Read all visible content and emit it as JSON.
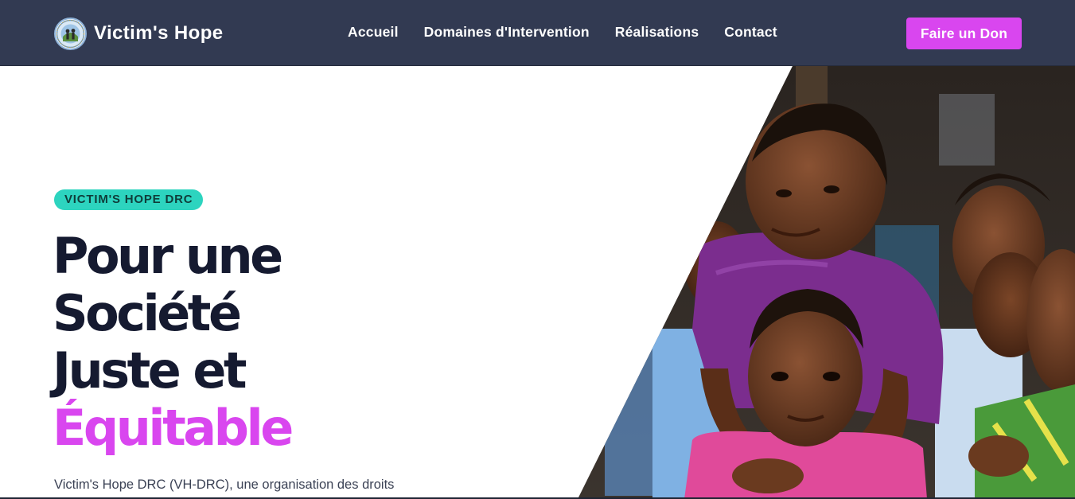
{
  "brand": {
    "name": "Victim's Hope",
    "logo_icon": "victims-hope-emblem"
  },
  "nav": {
    "items": [
      {
        "label": "Accueil"
      },
      {
        "label": "Domaines d'Intervention"
      },
      {
        "label": "Réalisations"
      },
      {
        "label": "Contact"
      }
    ],
    "donate_label": "Faire un Don"
  },
  "hero": {
    "badge": "VICTIM'S HOPE DRC",
    "title_lines": [
      "Pour une",
      "Société",
      "Juste et"
    ],
    "title_accent": "Équitable",
    "lead": "Victim's Hope DRC (VH-DRC), une organisation des droits",
    "image_alt": "Groupe d'enfants souriants"
  },
  "colors": {
    "navbar_bg": "#323a52",
    "accent": "#d946ef",
    "badge_bg": "#2dd4bf",
    "heading": "#151a30"
  }
}
